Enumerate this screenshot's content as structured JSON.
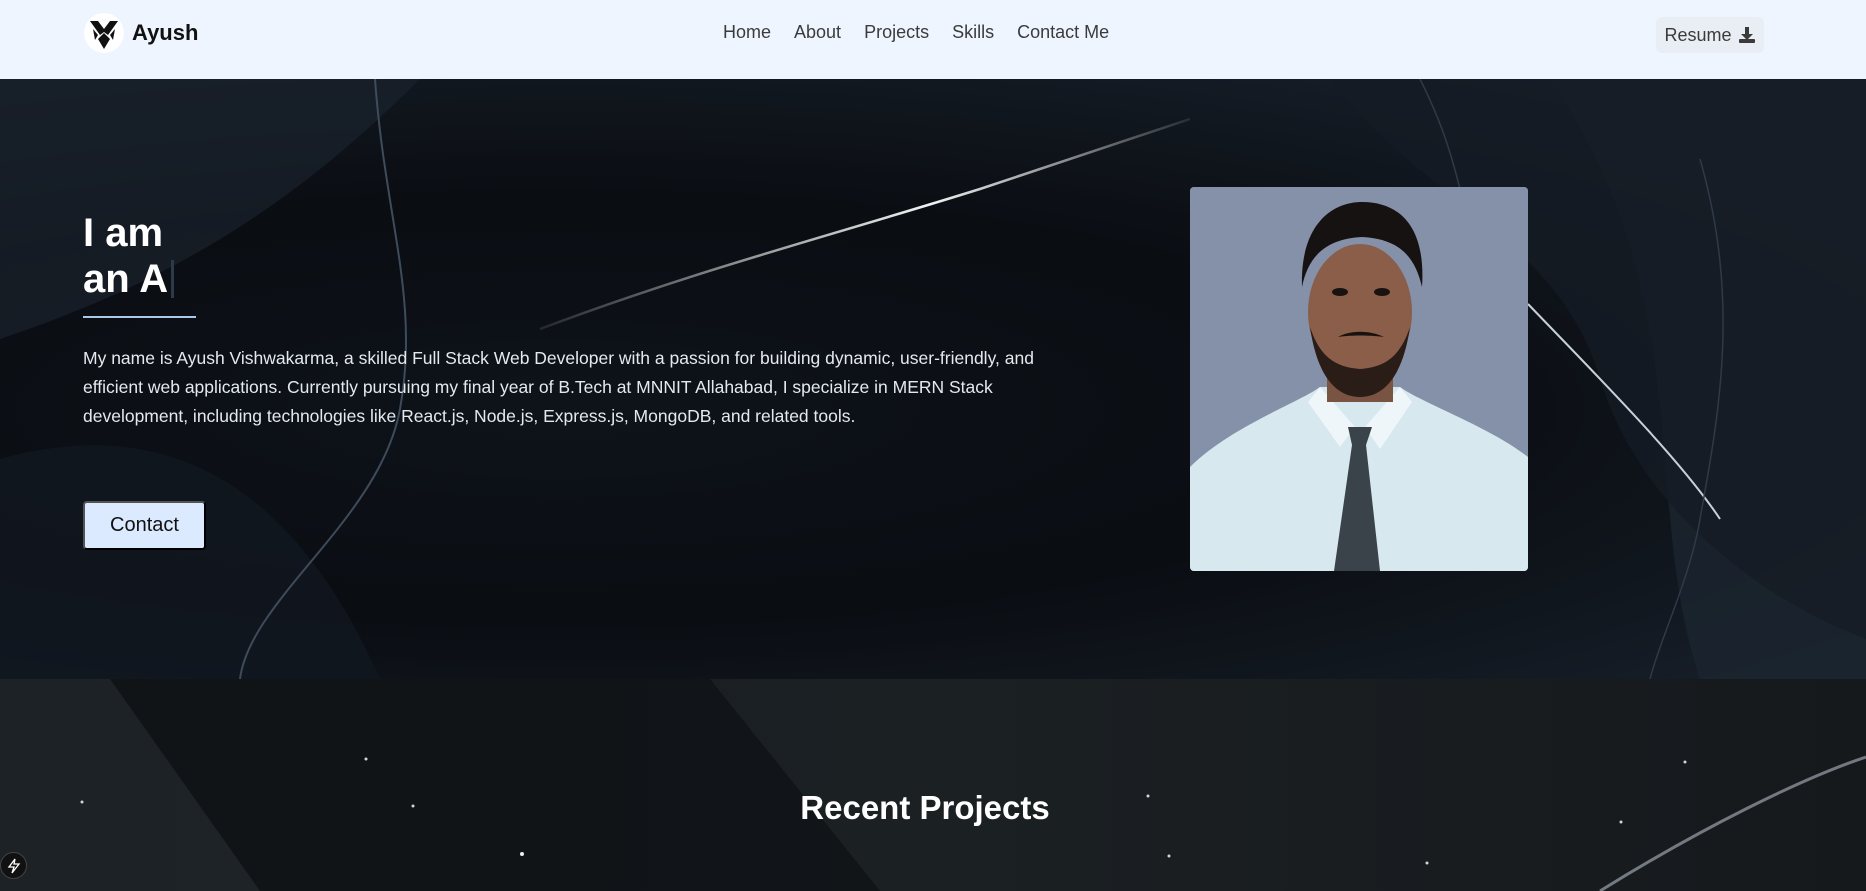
{
  "navbar": {
    "brand_name": "Ayush",
    "links": [
      "Home",
      "About",
      "Projects",
      "Skills",
      "Contact Me"
    ],
    "resume_label": "Resume"
  },
  "hero": {
    "title_line1": "I am",
    "title_line2": "an A",
    "description": "My name is Ayush Vishwakarma, a skilled Full Stack Web Developer with a passion for building dynamic, user-friendly, and efficient web applications. Currently pursuing my final year of B.Tech at MNNIT Allahabad, I specialize in MERN Stack development, including technologies like React.js, Node.js, Express.js, MongoDB, and related tools.",
    "contact_label": "Contact"
  },
  "projects": {
    "title": "Recent Projects"
  },
  "icons": {
    "logo": "logo-icon",
    "resume": "download-icon",
    "dev": "lightning-icon"
  },
  "colors": {
    "navbar_bg": "#eef5ff",
    "contact_bg": "#dbeafe",
    "accent_line": "#aac9ea"
  }
}
